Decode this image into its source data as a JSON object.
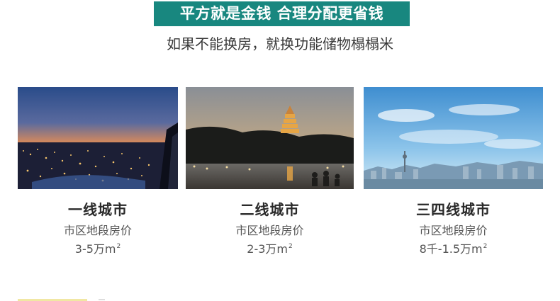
{
  "header": {
    "banner_text": "平方就是金钱 合理分配更省钱",
    "subtitle": "如果不能换房，就换功能储物榻榻米"
  },
  "colors": {
    "banner_bg": "#18877f",
    "banner_text": "#ffffff"
  },
  "cities": [
    {
      "name": "一线城市",
      "label": "市区地段房价",
      "price": "3-5万m",
      "unit_exp": "2"
    },
    {
      "name": "二线城市",
      "label": "市区地段房价",
      "price": "2-3万m",
      "unit_exp": "2"
    },
    {
      "name": "三四线城市",
      "label": "市区地段房价",
      "price": "8千-1.5万m",
      "unit_exp": "2"
    }
  ]
}
